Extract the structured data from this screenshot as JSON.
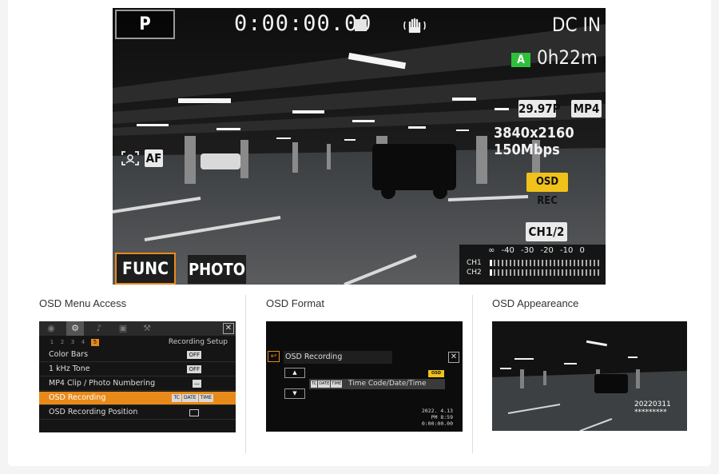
{
  "viewfinder": {
    "mode": "P",
    "timecode": "0:00:00.00",
    "power": "DC IN",
    "battery_badge": "A",
    "remaining": "0h22m",
    "frame_rate": "29.97P",
    "format": "MP4",
    "resolution": "3840x2160 150Mbps",
    "osd_rec_badge": "OSD REC",
    "af": "AF",
    "audio_channels": "CH1/2",
    "func_button": "FUNC",
    "photo_button": "PHOTO",
    "meter": {
      "scale": "∞ -40 -30 -20 -10 0",
      "ch1": "CH1",
      "ch2": "CH2",
      "ch1_level": 0.02,
      "ch2_level": 0.02
    }
  },
  "columns": {
    "menu_access_title": "OSD Menu Access",
    "format_title": "OSD Format",
    "appearance_title": "OSD Appeareance"
  },
  "menu": {
    "tab_icons": [
      "camera-icon",
      "record-setup-icon",
      "audio-icon",
      "playback-icon",
      "wrench-icon"
    ],
    "close": "✕",
    "pages": [
      "1",
      "2",
      "3",
      "4",
      "5"
    ],
    "active_page": "5",
    "section": "Recording Setup",
    "rows": [
      {
        "label": "Color Bars",
        "value": "OFF"
      },
      {
        "label": "1 kHz Tone",
        "value": "OFF"
      },
      {
        "label": "MP4 Clip / Photo Numbering",
        "value": "—"
      },
      {
        "label": "OSD Recording",
        "tags": [
          "TC",
          "DATE",
          "TIME"
        ]
      },
      {
        "label": "OSD Recording Position",
        "value": ""
      }
    ]
  },
  "format_panel": {
    "back": "↩",
    "title": "OSD Recording",
    "close": "✕",
    "up": "▲",
    "down": "▼",
    "osd_rec_badge": "OSD REC",
    "tags": [
      "TC",
      "DATE",
      "TIME"
    ],
    "option": "Time Code/Date/Time",
    "stamp_date": "2022. 4.13",
    "stamp_time": "PM 8:59",
    "stamp_tc": "0:00:00.00"
  },
  "appearance_panel": {
    "stamp_date": "20220311",
    "stamp_stars": "*********"
  }
}
